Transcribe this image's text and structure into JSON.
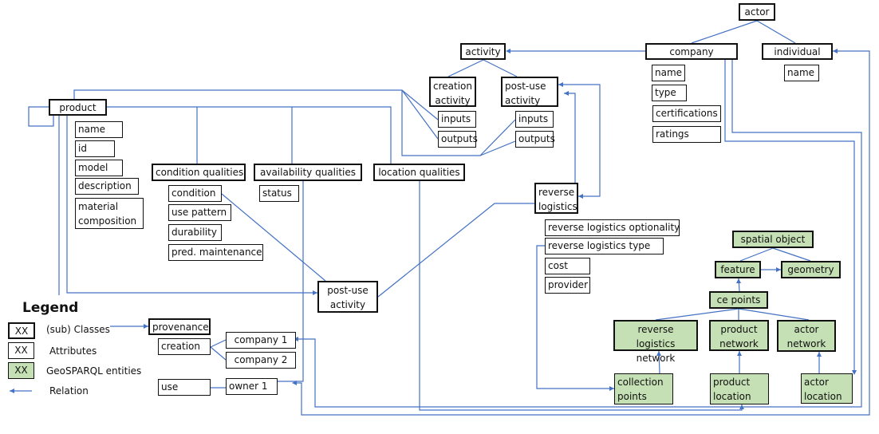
{
  "diagram": {
    "actor": {
      "label": "actor"
    },
    "company": {
      "label": "company",
      "attributes": [
        "name",
        "type",
        "certifications",
        "ratings"
      ]
    },
    "individual": {
      "label": "individual",
      "attributes": [
        "name"
      ]
    },
    "activity": {
      "label": "activity"
    },
    "creation_activity": {
      "label": "creation activity",
      "attributes": [
        "inputs",
        "outputs"
      ]
    },
    "post_use_activity": {
      "label": "post-use activity",
      "attributes": [
        "inputs",
        "outputs"
      ]
    },
    "product": {
      "label": "product",
      "attributes": [
        "name",
        "id",
        "model",
        "description",
        "material composition"
      ]
    },
    "condition_qualities": {
      "label": "condition qualities",
      "attributes": [
        "condition",
        "use pattern",
        "durability",
        "pred. maintenance"
      ]
    },
    "availability_qualities": {
      "label": "availability qualities",
      "attributes": [
        "status"
      ]
    },
    "location_qualities": {
      "label": "location qualities"
    },
    "reverse_logistics": {
      "label": "reverse logistics",
      "attributes": [
        "reverse logistics optionality",
        "reverse logistics type",
        "cost",
        "provider"
      ]
    },
    "post_use_activity_2": {
      "label": "post-use activity"
    },
    "geosparql": {
      "spatial_object": "spatial object",
      "feature": "feature",
      "geometry": "geometry",
      "ce_points": "ce points",
      "reverse_logistics_network": "reverse logistics network",
      "product_network": "product network",
      "actor_network": "actor network",
      "collection_points": "collection points",
      "product_location": "product location",
      "actor_location": "actor location"
    },
    "provenance": {
      "label": "provenance",
      "creation": "creation",
      "company_1": "company 1",
      "company_2": "company 2",
      "use": "use",
      "owner_1": "owner 1"
    }
  },
  "legend": {
    "title": "Legend",
    "sample": "XX",
    "items": [
      "(sub) Classes",
      "Attributes",
      "GeoSPARQL entities",
      "Relation"
    ]
  },
  "colors": {
    "relation": "#4472c4",
    "geosparql_fill": "#c5e0b4"
  }
}
